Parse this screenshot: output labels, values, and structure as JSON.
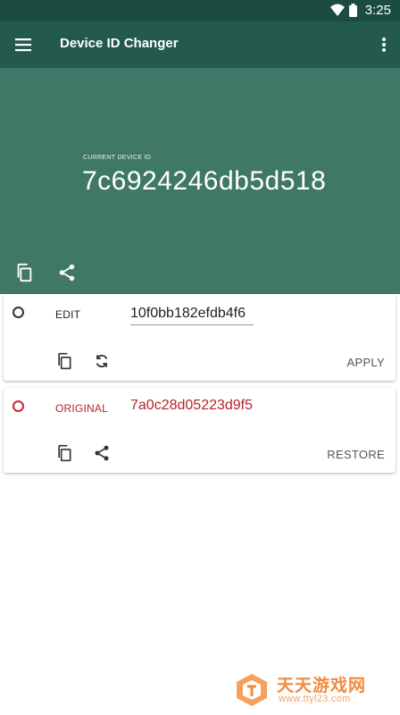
{
  "status_bar": {
    "time": "3:25",
    "icons": [
      "wifi-icon",
      "battery-icon"
    ]
  },
  "app_bar": {
    "title": "Device ID Changer",
    "menu_icon": "menu-icon",
    "overflow_icon": "more-vert-icon"
  },
  "header": {
    "label": "CURRENT DEVICE ID",
    "device_id": "7c6924246db5d518",
    "icons": [
      "copy-icon",
      "share-icon"
    ]
  },
  "edit_card": {
    "label": "EDIT",
    "value": "10f0bb182efdb4f6",
    "action": "APPLY",
    "icons": [
      "copy-icon",
      "refresh-icon"
    ]
  },
  "original_card": {
    "label": "ORIGINAL",
    "value": "7a0c28d05223d9f5",
    "action": "RESTORE",
    "icons": [
      "copy-icon",
      "share-icon"
    ]
  },
  "watermark": {
    "title": "天天游戏网",
    "url": "www.ttyl23.com"
  },
  "colors": {
    "status_bar": "#1c4c3f",
    "app_bar": "#235a4b",
    "header": "#3f7866",
    "accent_red": "#c62b35"
  }
}
